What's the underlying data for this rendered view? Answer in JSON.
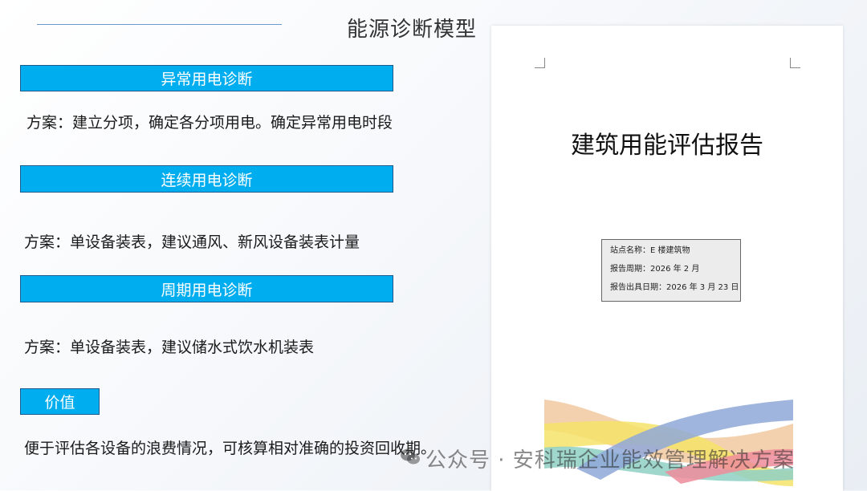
{
  "title": "能源诊断模型",
  "sections": [
    {
      "heading": "异常用电诊断",
      "plan": "方案：建立分项，确定各分项用电。确定异常用电时段"
    },
    {
      "heading": "连续用电诊断",
      "plan": "方案：单设备装表，建议通风、新风设备装表计量"
    },
    {
      "heading": "周期用电诊断",
      "plan": "方案：单设备装表，建议储水式饮水机装表"
    }
  ],
  "value": {
    "heading": "价值",
    "text": "便于评估各设备的浪费情况，可核算相对准确的投资回收期。"
  },
  "report": {
    "title": "建筑用能评估报告",
    "site": "站点名称：E 楼建筑物",
    "period": "报告周期：2026 年 2 月",
    "issue_date": "报告出具日期：2026 年 3 月 23 日"
  },
  "watermark": "公众号 · 安科瑞企业能效管理解决方案",
  "colors": {
    "bar_fill": "#00aeef",
    "bar_border": "#1b5a8e"
  }
}
